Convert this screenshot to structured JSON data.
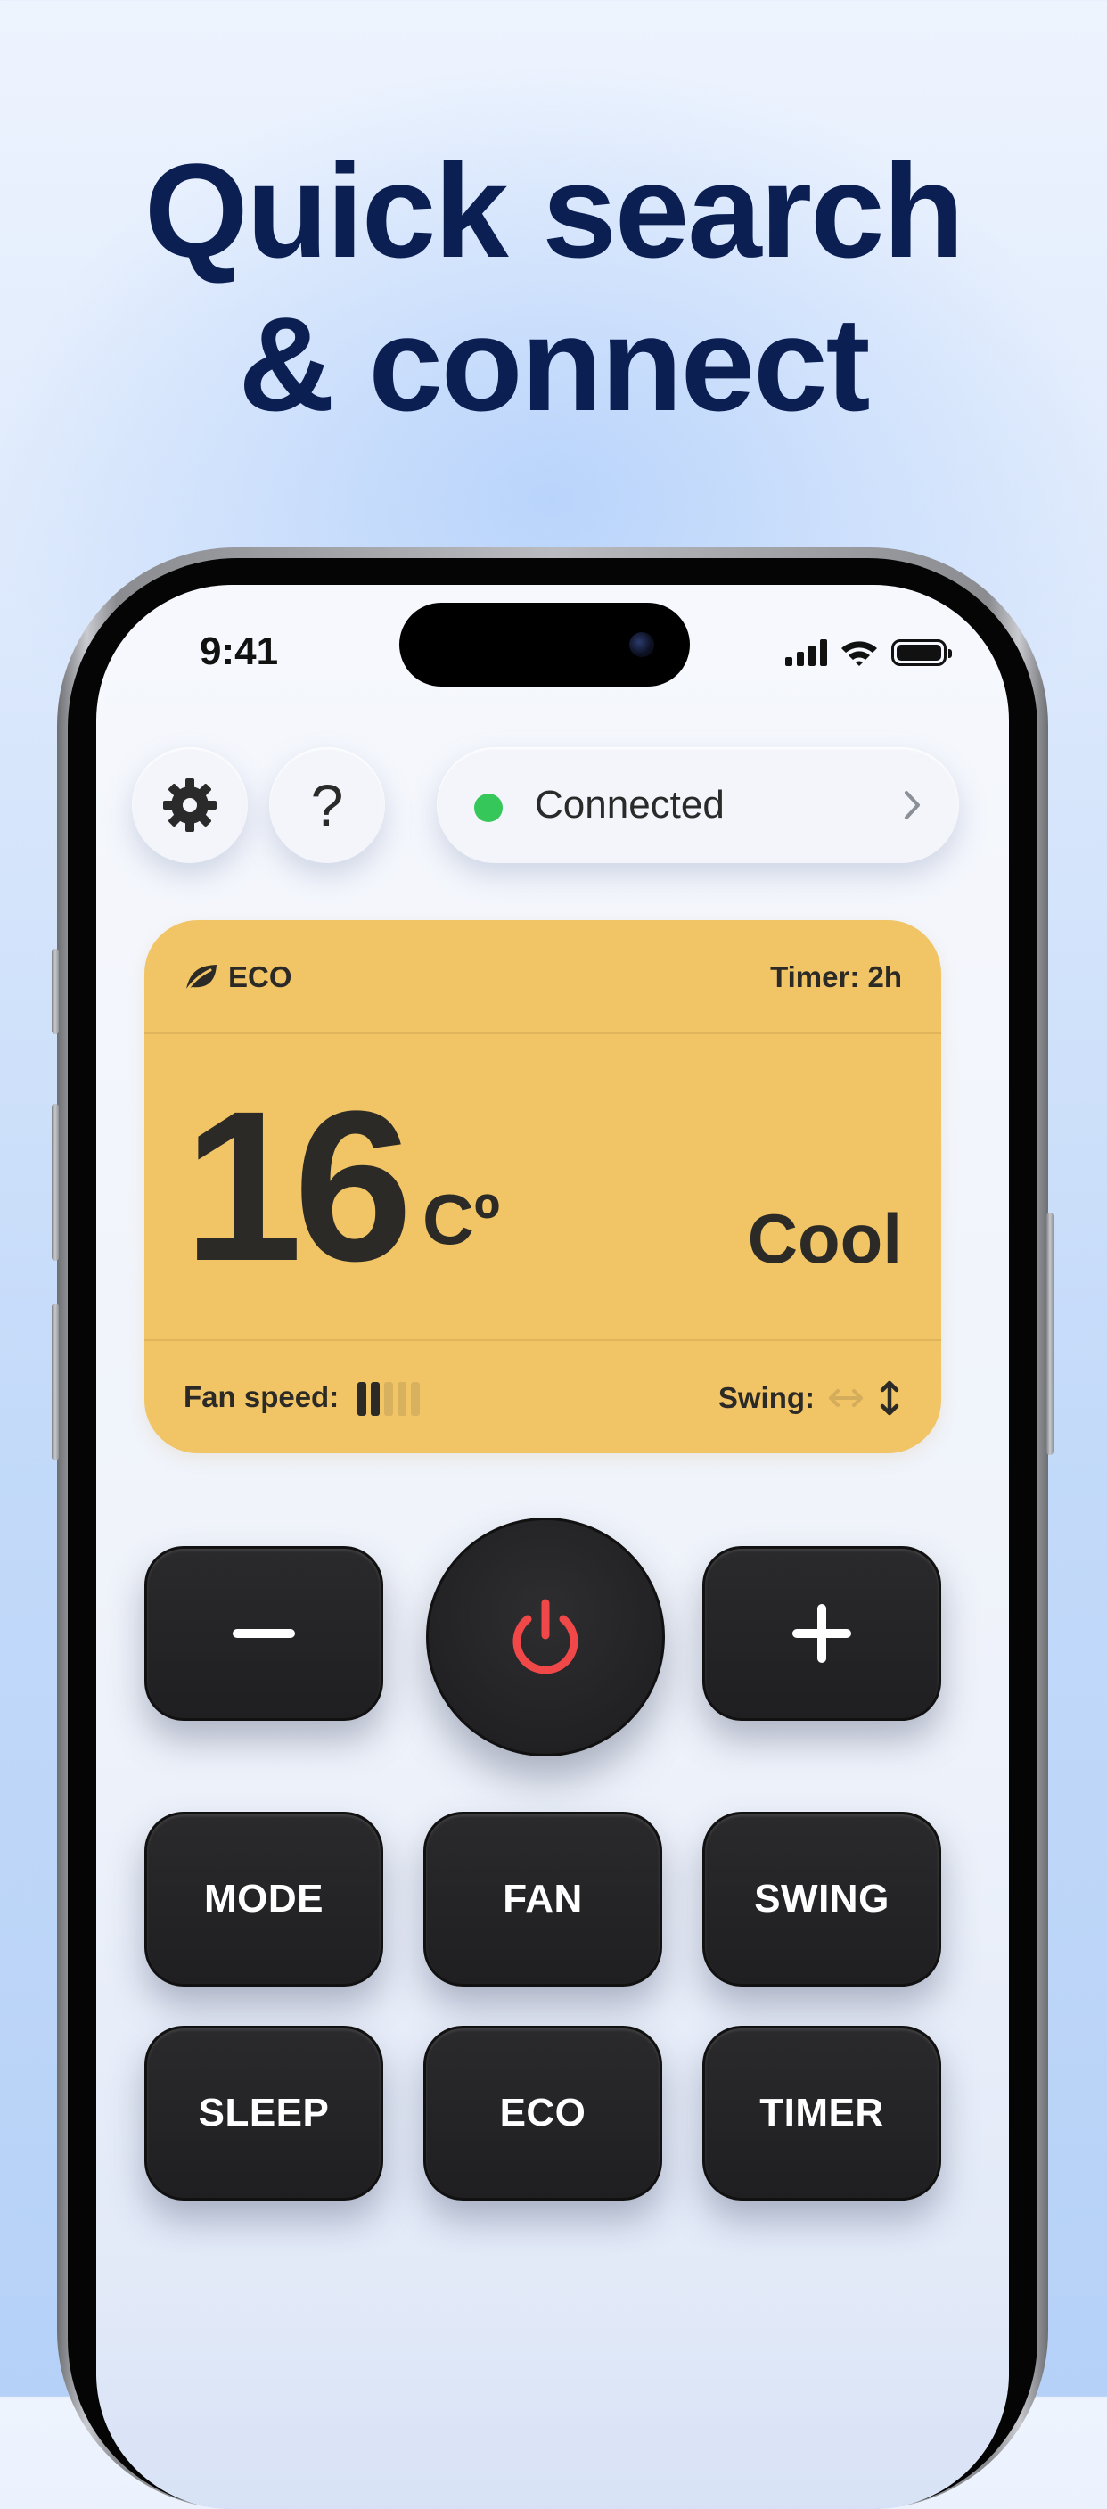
{
  "headline": {
    "line1": "Quick search",
    "line2": "& connect"
  },
  "status_bar": {
    "time": "9:41"
  },
  "top_controls": {
    "help_label": "?",
    "connection_label": "Connected",
    "connection_status_color": "#35c759"
  },
  "display": {
    "eco_label": "ECO",
    "timer_label": "Timer: 2h",
    "temperature": "16",
    "temperature_unit": "Cº",
    "mode": "Cool",
    "fan_speed_label": "Fan speed:",
    "fan_speed_level": 2,
    "fan_speed_max": 5,
    "swing_label": "Swing:",
    "swing_active": "vertical",
    "panel_color": "#f1c466"
  },
  "remote": {
    "minus_label": "−",
    "plus_label": "+",
    "power_color": "#f04848",
    "mode_label": "MODE",
    "fan_label": "FAN",
    "swing_label": "SWING",
    "sleep_label": "SLEEP",
    "eco_label": "ECO",
    "timer_label": "TIMER"
  }
}
